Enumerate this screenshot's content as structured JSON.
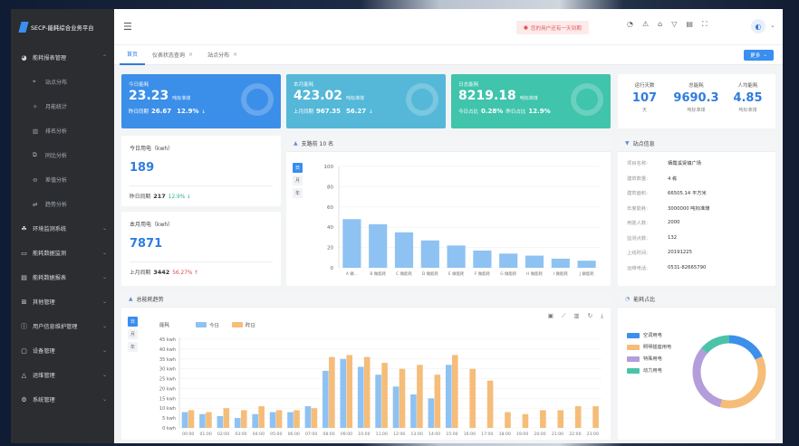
{
  "app": {
    "title": "SECP-能耗综合业务平台"
  },
  "sidebar": {
    "items": [
      {
        "label": "能耗报表管理",
        "icon": "chart-circle-icon",
        "expanded": true
      },
      {
        "label": "站点分布",
        "icon": "location-icon",
        "sub": true
      },
      {
        "label": "月能统计",
        "icon": "star-icon",
        "sub": true
      },
      {
        "label": "排名分析",
        "icon": "bar-chart-icon",
        "sub": true
      },
      {
        "label": "同比分析",
        "icon": "copy-icon",
        "sub": true
      },
      {
        "label": "差值分析",
        "icon": "minus-circle-icon",
        "sub": true
      },
      {
        "label": "趋势分析",
        "icon": "swap-icon",
        "sub": true
      },
      {
        "label": "环境监测系统",
        "icon": "leaf-icon"
      },
      {
        "label": "能耗数据监测",
        "icon": "monitor-icon"
      },
      {
        "label": "能耗数据报表",
        "icon": "report-icon"
      },
      {
        "label": "其他管理",
        "icon": "grid-icon"
      },
      {
        "label": "用户信息维护管理",
        "icon": "user-info-icon"
      },
      {
        "label": "设备管理",
        "icon": "device-icon"
      },
      {
        "label": "运维管理",
        "icon": "wrench-icon"
      },
      {
        "label": "系统管理",
        "icon": "gear-icon"
      }
    ]
  },
  "header": {
    "alert": "您的用户还有一天到期"
  },
  "tabs": [
    {
      "label": "首页",
      "active": true
    },
    {
      "label": "仪表状态查询",
      "closable": true
    },
    {
      "label": "站点分布",
      "closable": true
    }
  ],
  "more_button": "更多",
  "kpis": [
    {
      "title": "今日能耗",
      "value": "23.23",
      "unit": "吨标准煤",
      "cmp_label": "昨日同期",
      "cmp_value": "26.67",
      "pct": "12.9%",
      "arrow": "↓",
      "color": "#3b8fe8"
    },
    {
      "title": "本月能耗",
      "value": "423.02",
      "unit": "吨标准煤",
      "cmp_label": "上月同期",
      "cmp_value": "967.35",
      "pct": "56.27",
      "arrow": "↓",
      "color": "#55b8d8"
    },
    {
      "title": "日志能耗",
      "value": "8219.18",
      "unit": "吨标准煤",
      "cmp_label": "今日占比",
      "cmp_value": "0.28%",
      "pct_label": "昨日占比",
      "pct": "12.9%",
      "arrow": "",
      "color": "#40c4ac"
    }
  ],
  "summary": [
    {
      "label": "运行天数",
      "value": "107",
      "unit": "天"
    },
    {
      "label": "总能耗",
      "value": "9690.3",
      "unit": "吨标准煤"
    },
    {
      "label": "人均能耗",
      "value": "4.85",
      "unit": "吨标准煤"
    }
  ],
  "today_elec": {
    "title": "今日用电（kwh）",
    "value": "189",
    "cmp_label": "昨日同期",
    "cmp_value": "217",
    "pct": "12.9%",
    "arrow": "↓"
  },
  "month_elec": {
    "title": "本月用电（kwh）",
    "value": "7871",
    "cmp_label": "上月同期",
    "cmp_value": "3442",
    "pct": "56.27%",
    "arrow": "↑"
  },
  "rank_panel": {
    "title": "支路前 10 名",
    "toggles": [
      "日",
      "月",
      "年"
    ]
  },
  "station_info": {
    "title": "站点信息",
    "rows": [
      {
        "k": "项目名称:",
        "v": "栖霞溪贤镇广场"
      },
      {
        "k": "建筑数量:",
        "v": "4 栋"
      },
      {
        "k": "建筑面积:",
        "v": "66505.14 平方米"
      },
      {
        "k": "年度能耗:",
        "v": "3000000 吨标准煤"
      },
      {
        "k": "用能人数:",
        "v": "2000"
      },
      {
        "k": "监测点数:",
        "v": "132"
      },
      {
        "k": "上线时间:",
        "v": "20191225"
      },
      {
        "k": "运维电话:",
        "v": "0531-82665790"
      }
    ]
  },
  "trend_panel": {
    "title": "总能耗趋势",
    "toggles": [
      "日",
      "月",
      "年"
    ]
  },
  "ratio_panel": {
    "title": "能耗占比"
  },
  "chart_data": [
    {
      "type": "bar",
      "title": "支路前 10 名",
      "categories": [
        "A 做...",
        "B 做能耗",
        "C 做能耗",
        "D 做能耗",
        "E 做能耗",
        "F 做能耗",
        "G 做能耗",
        "H 做能耗",
        "I 做能耗",
        "J 做能耗"
      ],
      "values": [
        48,
        43,
        35,
        27,
        22,
        17,
        14,
        12,
        9,
        7
      ],
      "ylim": [
        0,
        100
      ],
      "yticks": [
        0,
        20,
        40,
        60,
        80,
        100
      ],
      "color": "#8ec2f2"
    },
    {
      "type": "bar",
      "title": "",
      "ylabel": "能耗",
      "categories": [
        "00:00",
        "01:00",
        "02:00",
        "03:00",
        "04:00",
        "05:00",
        "06:00",
        "07:00",
        "08:00",
        "09:00",
        "10:00",
        "11:00",
        "12:00",
        "13:00",
        "14:00",
        "15:00",
        "16:00",
        "17:00",
        "18:00",
        "19:00",
        "20:00",
        "21:00",
        "22:00",
        "23:00"
      ],
      "series": [
        {
          "name": "今日",
          "color": "#8ec2f2",
          "values": [
            8,
            7,
            6,
            5,
            7,
            8,
            8,
            11,
            29,
            35,
            31,
            27,
            21,
            17,
            15,
            32,
            0,
            0,
            0,
            0,
            0,
            0,
            0,
            0
          ]
        },
        {
          "name": "昨日",
          "color": "#f5bd79",
          "values": [
            9,
            8,
            10,
            9,
            11,
            9,
            9,
            10,
            36,
            37,
            36,
            33,
            30,
            32,
            27,
            37,
            30,
            24,
            8,
            7,
            9,
            9,
            11,
            11
          ]
        }
      ],
      "ylim": [
        0,
        45
      ],
      "yticks": [
        "0 kwh",
        "5 kwh",
        "10 kwh",
        "15 kwh",
        "20 kwh",
        "25 kwh",
        "30 kwh",
        "35 kwh",
        "40 kwh",
        "45 kwh"
      ],
      "legend": "top-left"
    },
    {
      "type": "pie",
      "title": "能耗占比",
      "labels": [
        "空调用电",
        "照明插座用电",
        "特殊用电",
        "动力用电"
      ],
      "values": [
        18,
        36,
        32,
        14
      ],
      "colors": [
        "#3d8fe9",
        "#f5bd79",
        "#b39ddb",
        "#4cc3a9"
      ]
    }
  ]
}
